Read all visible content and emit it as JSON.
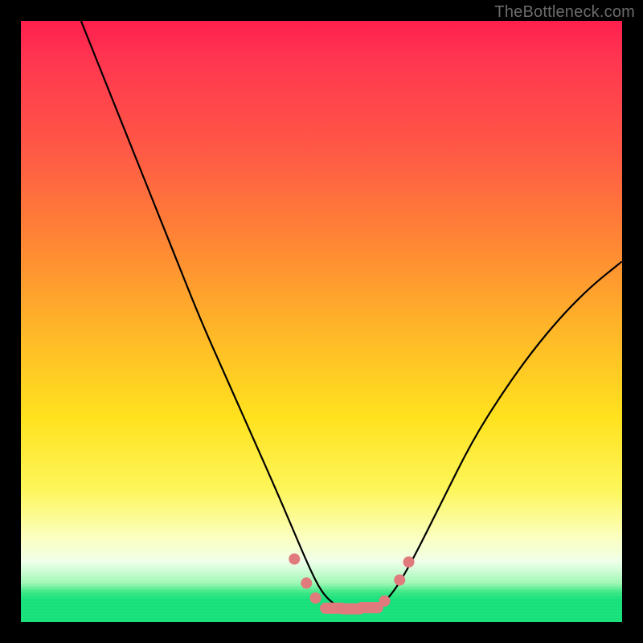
{
  "watermark": {
    "text": "TheBottleneck.com"
  },
  "chart_data": {
    "type": "line",
    "title": "",
    "xlabel": "",
    "ylabel": "",
    "xlim": [
      0,
      100
    ],
    "ylim": [
      0,
      100
    ],
    "grid": false,
    "legend": false,
    "background_gradient": {
      "top": "#ff1f4e",
      "mid": "#ffe21e",
      "bottom": "#18e07a"
    },
    "series": [
      {
        "name": "bottleneck-curve",
        "color": "#000000",
        "x": [
          10,
          14,
          18,
          22,
          26,
          30,
          34,
          38,
          42,
          45,
          48,
          50,
          52,
          54,
          56,
          58,
          60,
          62,
          65,
          70,
          75,
          80,
          85,
          90,
          95,
          100
        ],
        "y": [
          100,
          90,
          80,
          70,
          60,
          50,
          41,
          32,
          23,
          16,
          9,
          5,
          3,
          2,
          2,
          2,
          3,
          5,
          10,
          20,
          30,
          38,
          45,
          51,
          56,
          60
        ]
      }
    ],
    "markers": {
      "name": "highlight-points",
      "color": "#e07a7d",
      "points": [
        {
          "x": 45.5,
          "y": 10.5
        },
        {
          "x": 47.5,
          "y": 6.5
        },
        {
          "x": 49.0,
          "y": 4.0
        },
        {
          "x": 52.0,
          "y": 2.3
        },
        {
          "x": 55.0,
          "y": 2.2
        },
        {
          "x": 58.0,
          "y": 2.4
        },
        {
          "x": 60.5,
          "y": 3.5
        },
        {
          "x": 63.0,
          "y": 7.0
        },
        {
          "x": 64.5,
          "y": 10.0
        }
      ]
    }
  }
}
